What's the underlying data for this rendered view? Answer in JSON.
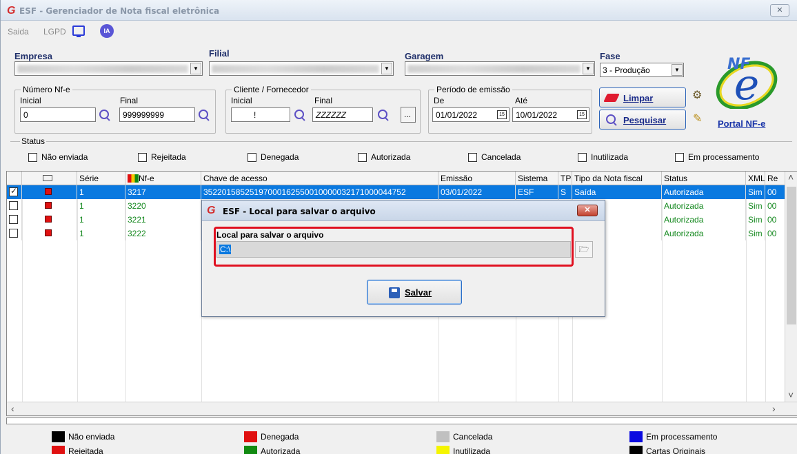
{
  "window": {
    "title": "ESF - Gerenciador de Nota fiscal eletrônica",
    "close_glyph": "✕"
  },
  "menu": {
    "items": [
      "Saida",
      "LGPD"
    ],
    "ia_label": "IA"
  },
  "filters": {
    "empresa_label": "Empresa",
    "filial_label": "Filial",
    "garagem_label": "Garagem",
    "fase_label": "Fase",
    "fase_value": "3 - Produção",
    "numero": {
      "group_title": "Número Nf-e",
      "inicial_label": "Inicial",
      "final_label": "Final",
      "inicial_value": "0",
      "final_value": "999999999"
    },
    "cliente": {
      "group_title": "Cliente / Fornecedor",
      "inicial_label": "Inicial",
      "final_label": "Final",
      "inicial_value": "!",
      "final_value": "ZZZZZZ",
      "more_label": "..."
    },
    "periodo": {
      "group_title": "Período de emissão",
      "de_label": "De",
      "ate_label": "Até",
      "de_value": "01/01/2022",
      "ate_value": "10/01/2022",
      "cal_text": "15"
    }
  },
  "buttons": {
    "limpar": "Limpar",
    "pesquisar": "Pesquisar"
  },
  "portal_link": "Portal NF-e",
  "nfe_logo_text": "NF-e",
  "status": {
    "title": "Status",
    "options": [
      "Não enviada",
      "Rejeitada",
      "Denegada",
      "Autorizada",
      "Cancelada",
      "Inutilizada",
      "Em processamento"
    ]
  },
  "grid": {
    "headers": [
      "",
      "",
      "Série",
      "Nf-e",
      "Chave de acesso",
      "Emissão",
      "Sistema",
      "TP",
      "Tipo da Nota fiscal",
      "Status",
      "XML",
      "Re"
    ],
    "rows": [
      {
        "checked": true,
        "serie": "1",
        "nfe": "3217",
        "chave": "35220158525197000162550010000032171000044752",
        "emissao": "03/01/2022",
        "sistema": "ESF",
        "tp": "S",
        "tipo": "Saída",
        "status": "Autorizada",
        "xml": "Sim",
        "re": "00"
      },
      {
        "checked": false,
        "serie": "1",
        "nfe": "3220",
        "chave": "",
        "emissao": "",
        "sistema": "",
        "tp": "",
        "tipo": "",
        "status": "Autorizada",
        "xml": "Sim",
        "re": "00"
      },
      {
        "checked": false,
        "serie": "1",
        "nfe": "3221",
        "chave": "",
        "emissao": "",
        "sistema": "",
        "tp": "",
        "tipo": "",
        "status": "Autorizada",
        "xml": "Sim",
        "re": "00"
      },
      {
        "checked": false,
        "serie": "1",
        "nfe": "3222",
        "chave": "",
        "emissao": "",
        "sistema": "",
        "tp": "",
        "tipo": "",
        "status": "Autorizada",
        "xml": "Sim",
        "re": "00"
      }
    ]
  },
  "legend": [
    {
      "label": "Não enviada",
      "color": "#000000"
    },
    {
      "label": "Denegada",
      "color": "#e01010"
    },
    {
      "label": "Cancelada",
      "color": "#c0c0c0"
    },
    {
      "label": "Em processamento",
      "color": "#0a0ae0"
    },
    {
      "label": "Rejeitada",
      "color": "#e01010"
    },
    {
      "label": "Autorizada",
      "color": "#118a11"
    },
    {
      "label": "Inutilizada",
      "color": "#f5f500"
    },
    {
      "label": "Cartas Originais",
      "color": "#000000"
    }
  ],
  "dialog": {
    "title": "ESF - Local para salvar o arquivo",
    "path_label": "Local para salvar o arquivo",
    "path_value": "C:\\",
    "save_label": "Salvar",
    "close_glyph": "✕"
  }
}
